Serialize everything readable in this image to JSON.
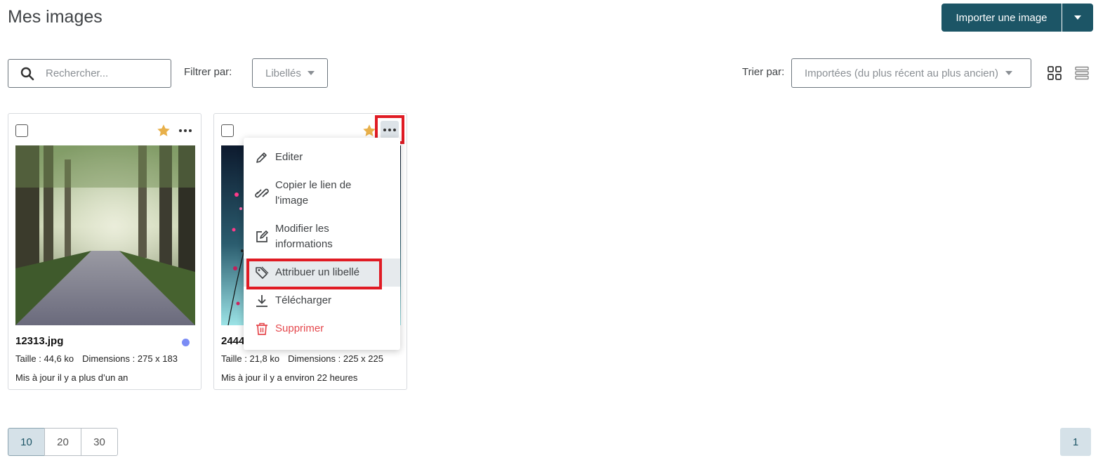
{
  "header": {
    "title": "Mes images",
    "import_label": "Importer une image"
  },
  "toolbar": {
    "search_placeholder": "Rechercher...",
    "filter_label": "Filtrer par:",
    "filter_value": "Libellés",
    "sort_label": "Trier par:",
    "sort_value": "Importées (du plus récent au plus ancien)"
  },
  "cards": [
    {
      "filename": "12313.jpg",
      "size": "Taille : 44,6 ko",
      "dimensions": "Dimensions : 275 x 183",
      "updated": "Mis à jour il y a plus d’un an",
      "favorite": true,
      "tag_color": "#7b8cf5"
    },
    {
      "filename": "2444",
      "size": "Taille : 21,8 ko",
      "dimensions": "Dimensions : 225 x 225",
      "updated": "Mis à jour il y a environ 22 heures",
      "favorite": true
    }
  ],
  "context_menu": {
    "items": [
      {
        "label": "Editer",
        "icon": "pencil-icon"
      },
      {
        "label": "Copier le lien de l'image",
        "icon": "link-icon"
      },
      {
        "label": "Modifier les informations",
        "icon": "edit-square-icon"
      },
      {
        "label": "Attribuer un libellé",
        "icon": "tag-icon"
      },
      {
        "label": "Télécharger",
        "icon": "download-icon"
      },
      {
        "label": "Supprimer",
        "icon": "trash-icon"
      }
    ]
  },
  "pagination": {
    "page_sizes": [
      "10",
      "20",
      "30"
    ],
    "current_page": "1"
  },
  "colors": {
    "primary": "#1c5566",
    "danger": "#e5484d",
    "star": "#e8b04a",
    "highlight": "#e01b24"
  }
}
